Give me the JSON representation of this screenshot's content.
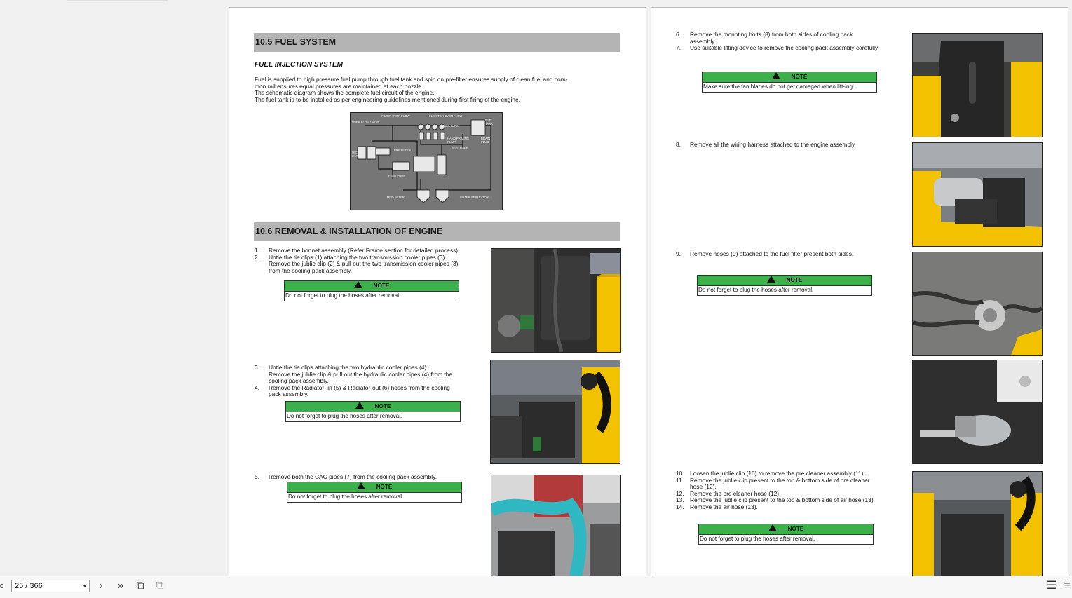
{
  "left_page": {
    "section_fuel": "10.5   FUEL SYSTEM",
    "subhead": "FUEL INJECTION SYSTEM",
    "paragraphs": [
      "Fuel is supplied to high pressure fuel pump through fuel tank and spin on pre-filter ensures supply of clean fuel and com-",
      "mon rail ensures equal pressures are maintained at each nozzle.",
      "The schematic diagram shows the complete fuel circuit of the engine.",
      "The fuel tank is to be installed as per engineering guidelines mentioned during first firing of the engine."
    ],
    "diagram_labels": {
      "filter_over_flow": "FILTER OVER FLOW",
      "injector_over_flow": "INJECTOR OVER FLOW",
      "over_flow_valve": "OVER FLOW VALVE",
      "injectors": "INJECTORS",
      "fuel_tank": "FUEL TANK",
      "hand_priming_pump": "HAND PRIMING PUMP",
      "drain_plug": "DRAIN PLUG",
      "micro_filter": "MICRO FILTER",
      "pre_filter": "PRE FILTER",
      "fuel_pump": "FUEL PUMP",
      "feed_pump": "FEED PUMP",
      "mud_filter": "MUD FILTER",
      "water_separator": "WATER SEPARATOR"
    },
    "section_removal": "10.6   REMOVAL & INSTALLATION OF ENGINE",
    "steps_a": [
      {
        "num": "1.",
        "text": "Remove the bonnet assembly (Refer Frame section for detailed process)."
      },
      {
        "num": "2.",
        "text": "Untie the tie clips (1) attaching the two transmission cooler pipes (3)."
      },
      {
        "num": "",
        "text": "Remove the jublie clip (2) & pull out the two transmission cooler pipes (3)"
      },
      {
        "num": "",
        "text": "from the cooling pack assembly."
      }
    ],
    "steps_b": [
      {
        "num": "3.",
        "text": "Untie the tie clips attaching the two hydraulic cooler pipes (4)."
      },
      {
        "num": "",
        "text": "Remove the jublie clip & pull out the hydraulic cooler pipes (4) from the"
      },
      {
        "num": "",
        "text": "cooling pack assembly."
      },
      {
        "num": "4.",
        "text": "Remove the Radiator- in (5) & Radiator-out (6) hoses from the cooling"
      },
      {
        "num": "",
        "text": "pack assembly."
      }
    ],
    "steps_c": [
      {
        "num": "5.",
        "text": "Remove both the CAC pipes (7) from the cooling pack assembly."
      }
    ],
    "note_label": "NOTE",
    "note_plug": "Do not forget to plug the hoses after removal."
  },
  "right_page": {
    "steps_a": [
      {
        "num": "6.",
        "text": "Remove the mounting bolts (8) from both sides of cooling pack"
      },
      {
        "num": "",
        "text": "assembly."
      },
      {
        "num": "7.",
        "text": "Use suitable lifting device to remove the cooling pack assembly carefully."
      }
    ],
    "note_fan": "Make sure the fan blades do not get damaged when lift-ing.",
    "steps_b": [
      {
        "num": "8.",
        "text": "Remove all the wiring harness attached to the engine assembly."
      }
    ],
    "steps_c": [
      {
        "num": "9.",
        "text": "Remove hoses (9) attached to the fuel filter present both sides."
      }
    ],
    "steps_d": [
      {
        "num": "10.",
        "text": "Loosen the jublie clip (10) to remove the pre cleaner assembly (11)."
      },
      {
        "num": "11.",
        "text": "Remove the jublie clip present to the top & bottom side of pre cleaner"
      },
      {
        "num": "",
        "text": "hose (12)."
      },
      {
        "num": "12.",
        "text": "Remove the pre cleaner hose (12)."
      },
      {
        "num": "13.",
        "text": "Remove the jublie clip present to the top & bottom side of air hose (13)."
      },
      {
        "num": "14.",
        "text": "Remove the air hose (13)."
      }
    ]
  },
  "toolbar": {
    "page_indicator": "25 / 366",
    "icons": [
      "prev-icon",
      "next-icon",
      "last-page-icon",
      "rotate-icon",
      "copy-icon",
      "list-icon",
      "menu-icon"
    ]
  },
  "colors": {
    "note_green": "#3cb04a",
    "section_gray": "#b4b4b4",
    "machine_yellow": "#f2c200"
  }
}
